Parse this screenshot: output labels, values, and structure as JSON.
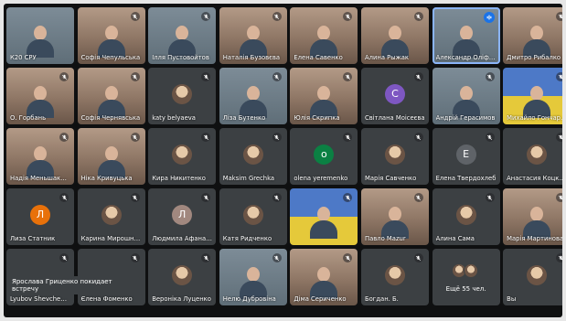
{
  "accent": "#8ab4f8",
  "toast": "Ярослава Гриценко покидает встречу",
  "tiles": [
    {
      "name": "К20 СРУ",
      "kind": "video",
      "tone": "cool",
      "mic": false
    },
    {
      "name": "Софія Чепульська",
      "kind": "video",
      "tone": "warm",
      "mic": true
    },
    {
      "name": "Ілля Пустовойтов",
      "kind": "video",
      "tone": "cool",
      "mic": true
    },
    {
      "name": "Наталія Бузовєва",
      "kind": "video",
      "tone": "warm",
      "mic": true
    },
    {
      "name": "Елена Савенко",
      "kind": "video",
      "tone": "warm",
      "mic": true
    },
    {
      "name": "Алина Рыжак",
      "kind": "video",
      "tone": "warm",
      "mic": true
    },
    {
      "name": "Александр Оліфіренко",
      "kind": "video",
      "tone": "cool",
      "mic": false,
      "active": true
    },
    {
      "name": "Дмитро Рибалко",
      "kind": "video",
      "tone": "warm",
      "mic": true
    },
    {
      "name": "О. Горбань",
      "kind": "video",
      "tone": "warm",
      "mic": true
    },
    {
      "name": "Софія Чернявська",
      "kind": "video",
      "tone": "warm",
      "mic": true
    },
    {
      "name": "katy belyaeva",
      "kind": "avatar",
      "avatar": "photo",
      "mic": true
    },
    {
      "name": "Ліза Бутенко",
      "kind": "video",
      "tone": "cool",
      "mic": true
    },
    {
      "name": "Юлія Скрипка",
      "kind": "video",
      "tone": "warm",
      "mic": true
    },
    {
      "name": "Світлана Моісеєва",
      "kind": "avatar",
      "letter": "C",
      "color": "#7e57c2",
      "mic": true
    },
    {
      "name": "Андрій Герасимов",
      "kind": "video",
      "tone": "cool",
      "mic": true
    },
    {
      "name": "Михайло Гончаров",
      "kind": "video",
      "tone": "blue",
      "mic": true
    },
    {
      "name": "Надія Меньшакова",
      "kind": "video",
      "tone": "warm",
      "mic": true
    },
    {
      "name": "Ніка Кривуцька",
      "kind": "video",
      "tone": "warm",
      "mic": true
    },
    {
      "name": "Кира Никитенко",
      "kind": "avatar",
      "avatar": "photo",
      "mic": true
    },
    {
      "name": "Maksim Grechka",
      "kind": "avatar",
      "avatar": "photo",
      "mic": true
    },
    {
      "name": "olena yeremenko",
      "kind": "avatar",
      "letter": "o",
      "color": "#0b8043",
      "mic": true
    },
    {
      "name": "Марія Савченко",
      "kind": "avatar",
      "avatar": "photo",
      "mic": true
    },
    {
      "name": "Елена Твердохлеб",
      "kind": "avatar",
      "letter": "Е",
      "color": "#5f6368",
      "mic": true
    },
    {
      "name": "Анастасия Коцкий",
      "kind": "avatar",
      "avatar": "photo",
      "mic": true
    },
    {
      "name": "Лиза Статник",
      "kind": "avatar",
      "letter": "Л",
      "color": "#e8710a",
      "mic": true
    },
    {
      "name": "Карина Мирошниченко",
      "kind": "avatar",
      "avatar": "photo",
      "mic": true
    },
    {
      "name": "Людмила Афанасьєва",
      "kind": "avatar",
      "letter": "Л",
      "color": "#a1887f",
      "mic": true
    },
    {
      "name": "Катя Ридченко",
      "kind": "avatar",
      "avatar": "photo",
      "mic": true
    },
    {
      "name": "",
      "kind": "video",
      "tone": "blue",
      "mic": true
    },
    {
      "name": "Павло Mazur",
      "kind": "video",
      "tone": "warm",
      "mic": true
    },
    {
      "name": "Алина Сама",
      "kind": "avatar",
      "avatar": "photo",
      "mic": true
    },
    {
      "name": "Марія Мартинова",
      "kind": "video",
      "tone": "warm",
      "mic": true
    },
    {
      "name": "Lyubov Shevchenko",
      "kind": "avatar",
      "avatar": "none",
      "mic": true
    },
    {
      "name": "Єлена Фоменко",
      "kind": "avatar",
      "avatar": "none",
      "mic": true
    },
    {
      "name": "Вероніка Луценко",
      "kind": "avatar",
      "avatar": "photo",
      "mic": true
    },
    {
      "name": "Нелю Дубровіна",
      "kind": "video",
      "tone": "cool",
      "mic": true
    },
    {
      "name": "Діма Сериченко",
      "kind": "video",
      "tone": "warm",
      "mic": true
    },
    {
      "name": "Богдан. Б.",
      "kind": "avatar",
      "avatar": "photo",
      "mic": true
    },
    {
      "name": "",
      "kind": "more",
      "more": "Ещё 55 чел.",
      "mic": false
    },
    {
      "name": "Вы",
      "kind": "avatar",
      "avatar": "photo",
      "mic": true
    }
  ]
}
